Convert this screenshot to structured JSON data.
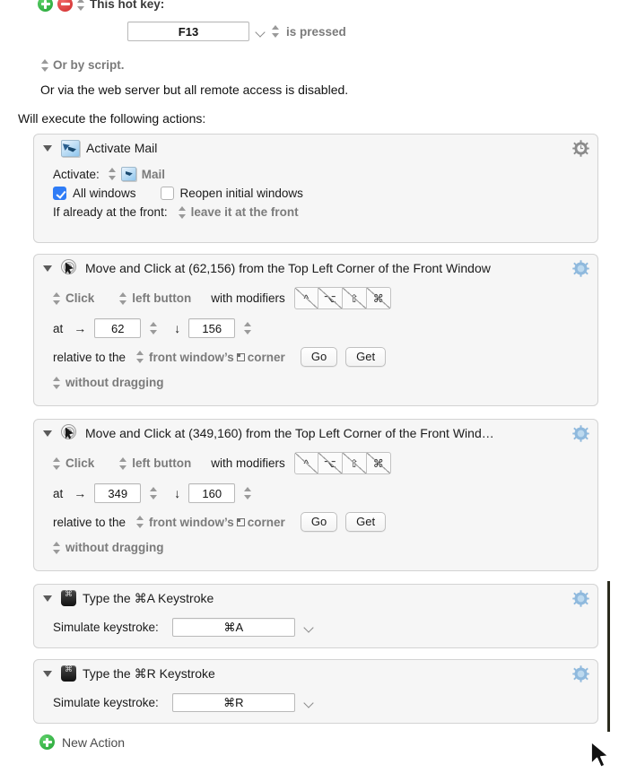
{
  "trigger": {
    "add_button": "add-trigger",
    "remove_button": "remove-trigger",
    "label": "This hot key:",
    "hotkey_value": "F13",
    "condition": "is pressed",
    "or_by_script": "Or by script.",
    "web_server_note": "Or via the web server but all remote access is disabled."
  },
  "actions_header": "Will execute the following actions:",
  "actions": [
    {
      "title": "Activate Mail",
      "icon": "mail-app-icon",
      "gear_color": "#8a8a8a",
      "activate_label": "Activate:",
      "target_app": "Mail",
      "all_windows_label": "All windows",
      "all_windows_checked": true,
      "reopen_label": "Reopen initial windows",
      "reopen_checked": false,
      "front_label": "If already at the front:",
      "front_value": "leave it at the front"
    },
    {
      "title": "Move and Click at (62,156) from the Top Left Corner of the Front Window",
      "icon": "click-ripple-icon",
      "gear_color": "#7fb4de",
      "click_action": "Click",
      "button": "left button",
      "modifiers_label": "with modifiers",
      "modifiers": [
        "^",
        "⌥",
        "⇧",
        "⌘"
      ],
      "at_label": "at",
      "x_value": "62",
      "y_value": "156",
      "relative_label": "relative to the",
      "relative_value": "front window’s",
      "corner_label": "corner",
      "go_label": "Go",
      "get_label": "Get",
      "drag_value": "without dragging"
    },
    {
      "title": "Move and Click at (349,160) from the Top Left Corner of the Front Wind…",
      "icon": "click-ripple-icon",
      "gear_color": "#7fb4de",
      "click_action": "Click",
      "button": "left button",
      "modifiers_label": "with modifiers",
      "modifiers": [
        "^",
        "⌥",
        "⇧",
        "⌘"
      ],
      "at_label": "at",
      "x_value": "349",
      "y_value": "160",
      "relative_label": "relative to the",
      "relative_value": "front window’s",
      "corner_label": "corner",
      "go_label": "Go",
      "get_label": "Get",
      "drag_value": "without dragging"
    },
    {
      "title": "Type the ⌘A Keystroke",
      "icon": "keycap-command-icon",
      "gear_color": "#7fb4de",
      "simulate_label": "Simulate keystroke:",
      "keystroke_value": "⌘A"
    },
    {
      "title": "Type the ⌘R Keystroke",
      "icon": "keycap-command-icon",
      "gear_color": "#7fb4de",
      "simulate_label": "Simulate keystroke:",
      "keystroke_value": "⌘R"
    }
  ],
  "new_action": {
    "label": "New Action"
  }
}
